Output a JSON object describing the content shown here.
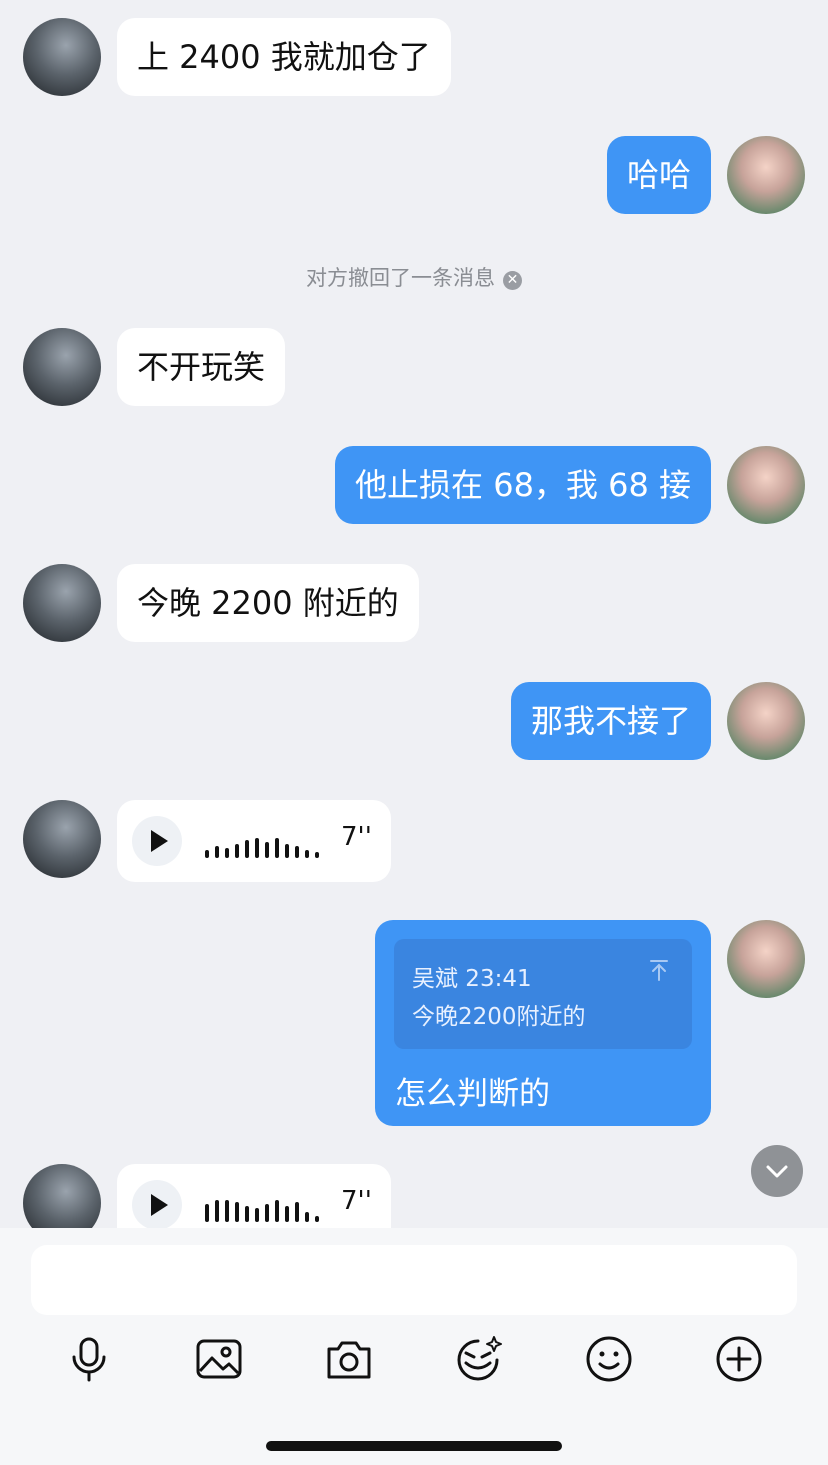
{
  "messages": [
    {
      "side": "in",
      "text": "上 2400 我就加仓了"
    },
    {
      "side": "out",
      "text": "哈哈"
    },
    {
      "side": "system",
      "text": "对方撤回了一条消息"
    },
    {
      "side": "in",
      "text": "不开玩笑"
    },
    {
      "side": "out",
      "text": "他止损在 68，我 68 接"
    },
    {
      "side": "in",
      "text": "今晚 2200 附近的"
    },
    {
      "side": "out",
      "text": "那我不接了"
    },
    {
      "side": "in",
      "type": "voice",
      "duration": "7''"
    },
    {
      "side": "out",
      "type": "quote-reply",
      "quote": {
        "author_time": "吴斌 23:41",
        "text": "今晚2200附近的"
      },
      "text": "怎么判断的"
    },
    {
      "side": "in",
      "type": "voice",
      "duration": "7''"
    }
  ],
  "colors": {
    "outgoing_bubble": "#3f95f5",
    "incoming_bubble": "#ffffff",
    "background": "#eff0f4"
  },
  "toolbar": {
    "icons": [
      "microphone-icon",
      "image-icon",
      "camera-icon",
      "sticker-icon",
      "emoji-icon",
      "plus-icon"
    ]
  }
}
